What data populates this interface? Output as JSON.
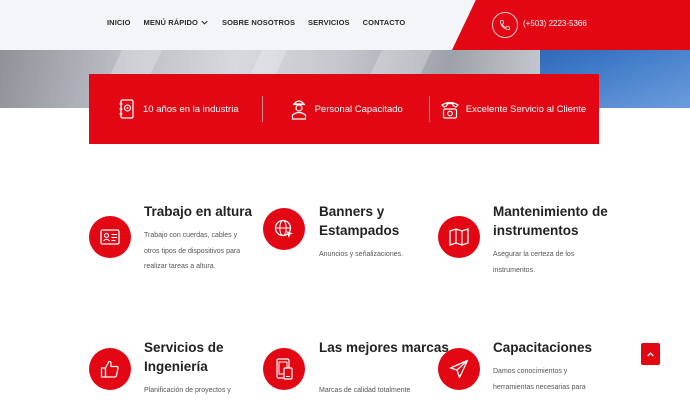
{
  "nav": {
    "items": [
      "INICIO",
      "MENÚ RÁPIDO",
      "SOBRE NOSOTROS",
      "SERVICIOS",
      "CONTACTO"
    ]
  },
  "header": {
    "phone": "(+503) 2223-5366"
  },
  "features": [
    {
      "label": "10 años en la industria",
      "icon": "address-book-icon"
    },
    {
      "label": "Personal Capacitado",
      "icon": "worker-icon"
    },
    {
      "label": "Excelente Servicio al Cliente",
      "icon": "telephone-icon"
    }
  ],
  "services": [
    {
      "title": "Trabajo en altura",
      "desc": "Trabajo con cuerdas, cables y otros tipos de dispositivos para realizar tareas a altura.",
      "icon": "id-card-icon"
    },
    {
      "title": "Banners y Estampados",
      "desc": "Anuncios y señalizaciones.",
      "icon": "globe-cursor-icon"
    },
    {
      "title": "Mantenimiento de instrumentos",
      "desc": "Asegurar la certeza de los instrumentos.",
      "icon": "map-icon"
    },
    {
      "title": "Servicios de Ingeniería",
      "desc": "Planificación de proyectos y",
      "icon": "thumbs-up-icon"
    },
    {
      "title": "Las mejores marcas",
      "desc": "Marcas de calidad totalmente",
      "icon": "devices-icon"
    },
    {
      "title": "Capacitaciones",
      "desc": "Damos conocimientos y herramientas necesarias para",
      "icon": "paper-plane-icon"
    }
  ],
  "colors": {
    "accent": "#e30613",
    "header_bg": "#f4f5f8"
  }
}
